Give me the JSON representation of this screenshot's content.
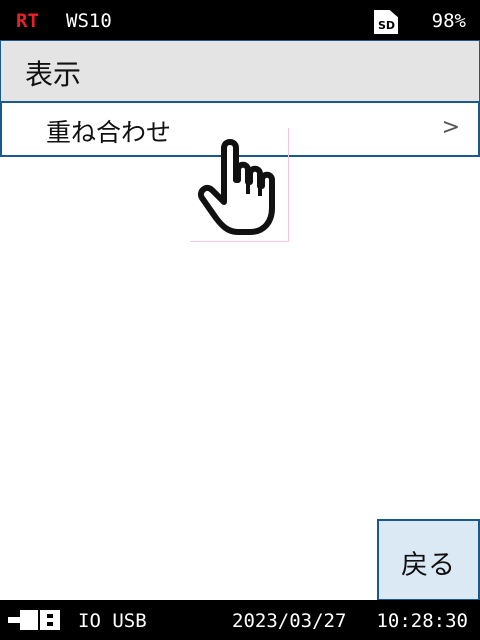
{
  "status_bar": {
    "mode": "RT",
    "channel": "WS10",
    "storage_icon": "sd-card-icon",
    "storage_label": "SD",
    "battery": "98%"
  },
  "header": {
    "title": "表示"
  },
  "menu": {
    "items": [
      {
        "label": "重ね合わせ",
        "chevron": ">"
      }
    ]
  },
  "buttons": {
    "back_label": "戻る"
  },
  "footer": {
    "connection_icon": "usb-connector-icon",
    "io_label": "IO USB",
    "date": "2023/03/27",
    "time": "10:28:30"
  },
  "overlay": {
    "cursor_icon": "pointing-hand-icon"
  },
  "colors": {
    "mode_red": "#e8202a",
    "accent_blue": "#1a5a8a",
    "header_gray": "#e4e4e4",
    "button_blue": "#dbe9f4"
  }
}
